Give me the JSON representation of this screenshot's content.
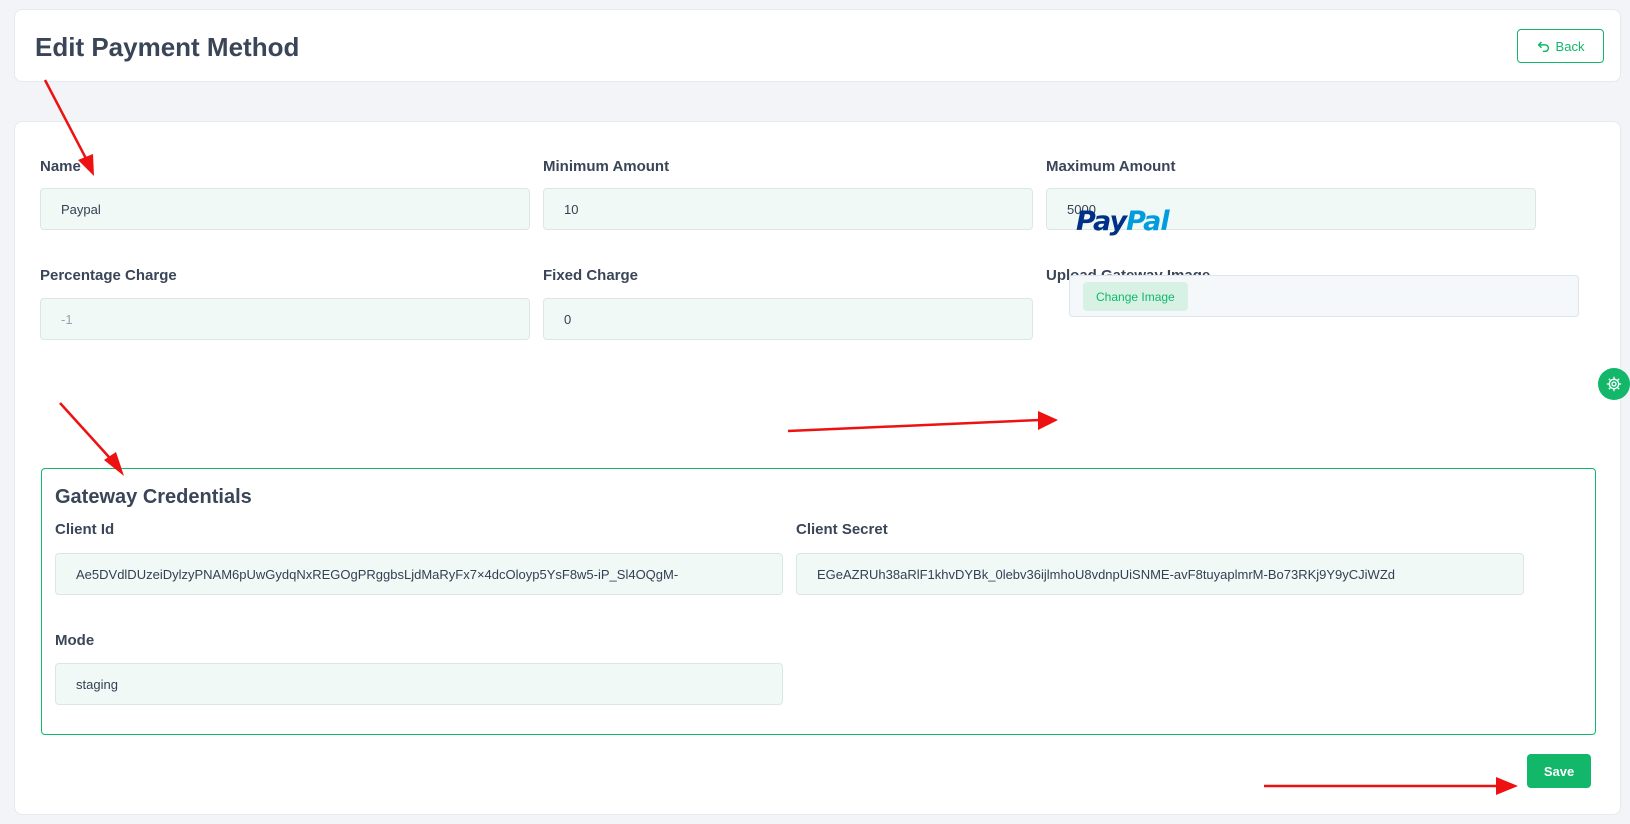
{
  "header": {
    "title": "Edit Payment Method",
    "back_label": "Back"
  },
  "form": {
    "name": {
      "label": "Name",
      "value": "Paypal"
    },
    "min_amount": {
      "label": "Minimum Amount",
      "value": "10"
    },
    "max_amount": {
      "label": "Maximum Amount",
      "value": "5000"
    },
    "percentage_charge": {
      "label": "Percentage Charge",
      "value": "-1"
    },
    "fixed_charge": {
      "label": "Fixed Charge",
      "value": "0"
    },
    "upload_image": {
      "label": "Upload Gateway Image",
      "button_label": "Change Image"
    },
    "logo": {
      "pay": "Pay",
      "pal": "Pal"
    }
  },
  "credentials": {
    "title": "Gateway Credentials",
    "client_id": {
      "label": "Client Id",
      "value": "Ae5DVdlDUzeiDylzyPNAM6pUwGydqNxREGOgPRggbsLjdMaRyFx7×4dcOloyp5YsF8w5-iP_Sl4OQgM-"
    },
    "client_secret": {
      "label": "Client Secret",
      "value": "EGeAZRUh38aRlF1khvDYBk_0lebv36ijlmhoU8vdnpUiSNME-avF8tuyaplmrM-Bo73RKj9Y9yCJiWZd"
    },
    "mode": {
      "label": "Mode",
      "value": "staging"
    }
  },
  "actions": {
    "save_label": "Save"
  },
  "colors": {
    "accent": "#12b76a",
    "input_bg": "#f1f9f6",
    "annotation_arrow": "#ee1111"
  },
  "icons": {
    "back": "undo-arrow-icon",
    "settings": "gear-icon"
  }
}
